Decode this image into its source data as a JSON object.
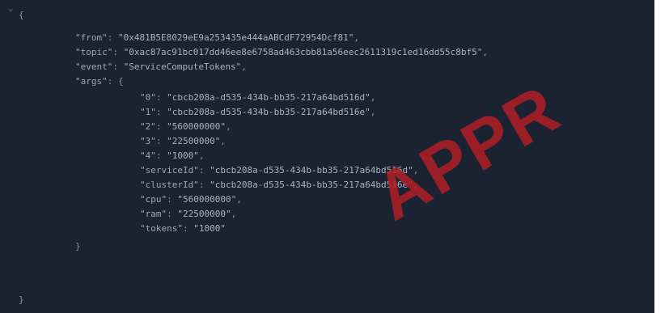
{
  "code": {
    "open_brace": "{",
    "close_brace": "}",
    "from_key": "\"from\"",
    "from_value": "\"0x481B5E8029eE9a253435e444aABCdF72954Dcf81\"",
    "topic_key": "\"topic\"",
    "topic_value": "\"0xac87ac91bc017dd46ee8e6758ad463cbb81a56eec2611319c1ed16dd55c8bf5\"",
    "event_key": "\"event\"",
    "event_value": "\"ServiceComputeTokens\"",
    "args_key": "\"args\"",
    "args_open": "{",
    "args_close": "}",
    "args": [
      {
        "key": "\"0\"",
        "value": "\"cbcb208a-d535-434b-bb35-217a64bd516d\""
      },
      {
        "key": "\"1\"",
        "value": "\"cbcb208a-d535-434b-bb35-217a64bd516e\""
      },
      {
        "key": "\"2\"",
        "value": "\"560000000\""
      },
      {
        "key": "\"3\"",
        "value": "\"22500000\""
      },
      {
        "key": "\"4\"",
        "value": "\"1000\""
      },
      {
        "key": "\"serviceId\"",
        "value": "\"cbcb208a-d535-434b-bb35-217a64bd516d\""
      },
      {
        "key": "\"clusterId\"",
        "value": "\"cbcb208a-d535-434b-bb35-217a64bd516e\""
      },
      {
        "key": "\"cpu\"",
        "value": "\"560000000\""
      },
      {
        "key": "\"ram\"",
        "value": "\"22500000\""
      },
      {
        "key": "\"tokens\"",
        "value": "\"1000\""
      }
    ]
  },
  "watermark": "APPR",
  "colors": {
    "background": "#1b2333",
    "watermark": "#b51e22"
  }
}
